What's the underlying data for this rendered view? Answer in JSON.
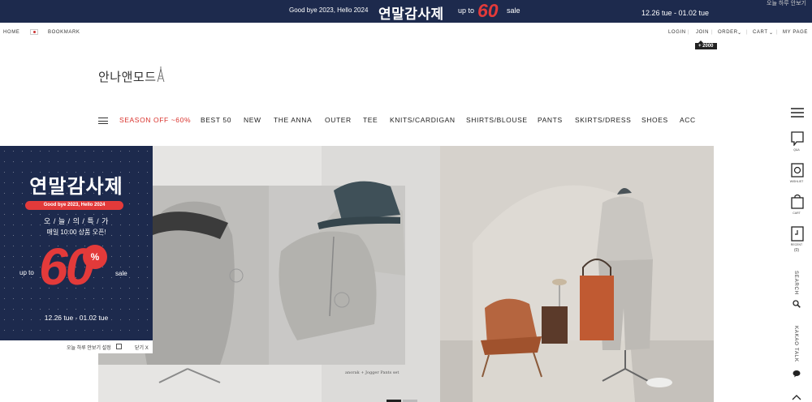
{
  "promo": {
    "lead": "Good bye 2023, Hello 2024",
    "korean_title": "연말감사제",
    "upto": "up to",
    "big": "60",
    "sale": "sale",
    "dates": "12.26 tue - 01.02 tue",
    "close_text": "오늘 하루 안보기"
  },
  "util": {
    "left": [
      "HOME",
      "BOOKMARK"
    ],
    "right": [
      "LOGIN",
      "JOIN",
      "ORDER",
      "CART",
      "MY PAGE"
    ],
    "points_badge": "+ 2000"
  },
  "logo": {
    "text": "안나앤모드"
  },
  "nav": {
    "items": [
      "SEASON OFF ~60%",
      "BEST 50",
      "NEW",
      "THE ANNA",
      "OUTER",
      "TEE",
      "KNITS/CARDIGAN",
      "SHIRTS/BLOUSE",
      "PANTS",
      "SKIRTS/DRESS",
      "SHOES",
      "ACC"
    ]
  },
  "popup": {
    "title": "연말감사제",
    "pill": "Good bye 2023, Hello 2024",
    "days": "오 / 늘 / 의 / 특 / 가",
    "daily": "매일 10:00 상품 오픈!",
    "upto": "up to",
    "big": "60",
    "pct": "%",
    "sale": "sale",
    "dates": "12.26 tue - 01.02 tue",
    "dismiss": "오늘 하루 안보기 설정",
    "close": "닫기 X"
  },
  "hero": {
    "caption": "anorak + Jogger Pants set"
  },
  "side": {
    "labels": [
      "Q&A",
      "WISHLIST",
      "CART",
      "RECENT"
    ],
    "recent_count": "(0)",
    "search": "SEARCH",
    "kakao": "KAKAO TALK"
  },
  "colors": {
    "navy": "#1d2a4d",
    "accent_red": "#e33a3a",
    "nav_red": "#d9312b"
  }
}
